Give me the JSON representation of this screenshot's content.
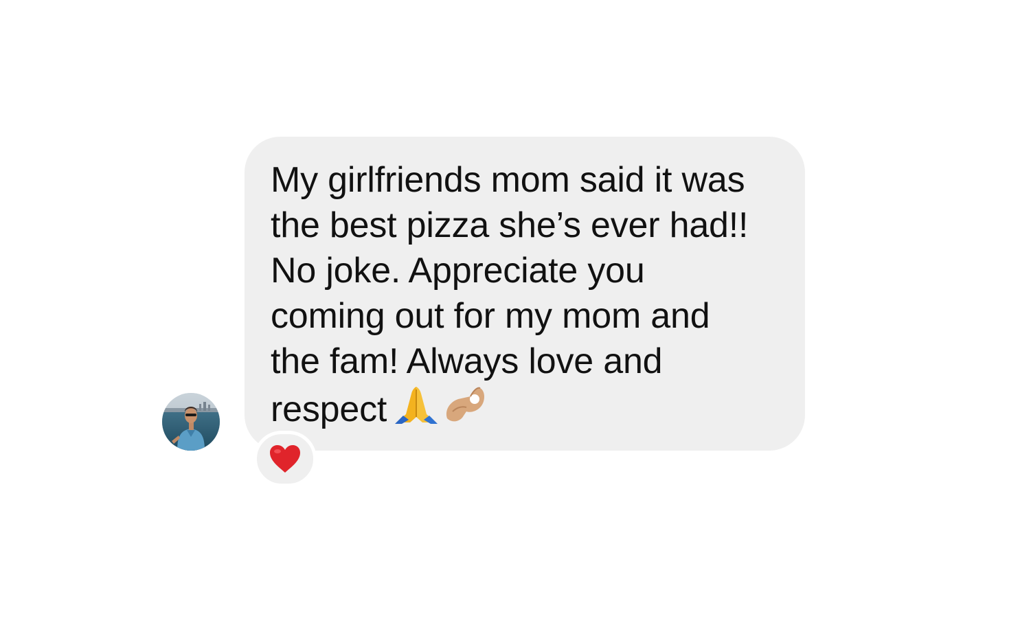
{
  "conversation": {
    "sender": {
      "avatar_icon": "profile-photo-avatar"
    },
    "message": {
      "lines": [
        "My girlfriends mom said it was",
        "the best pizza she’s ever had!!",
        "No joke. Appreciate you",
        "coming out for my mom and",
        "the fam! Always love and",
        "respect"
      ],
      "trailing_emojis": [
        "folded-hands-emoji",
        "ok-hand-emoji"
      ],
      "bubble_color": "#efefef",
      "text_color": "#111111"
    },
    "reaction": {
      "emoji": "red-heart-emoji",
      "color": "#e0242b"
    }
  }
}
